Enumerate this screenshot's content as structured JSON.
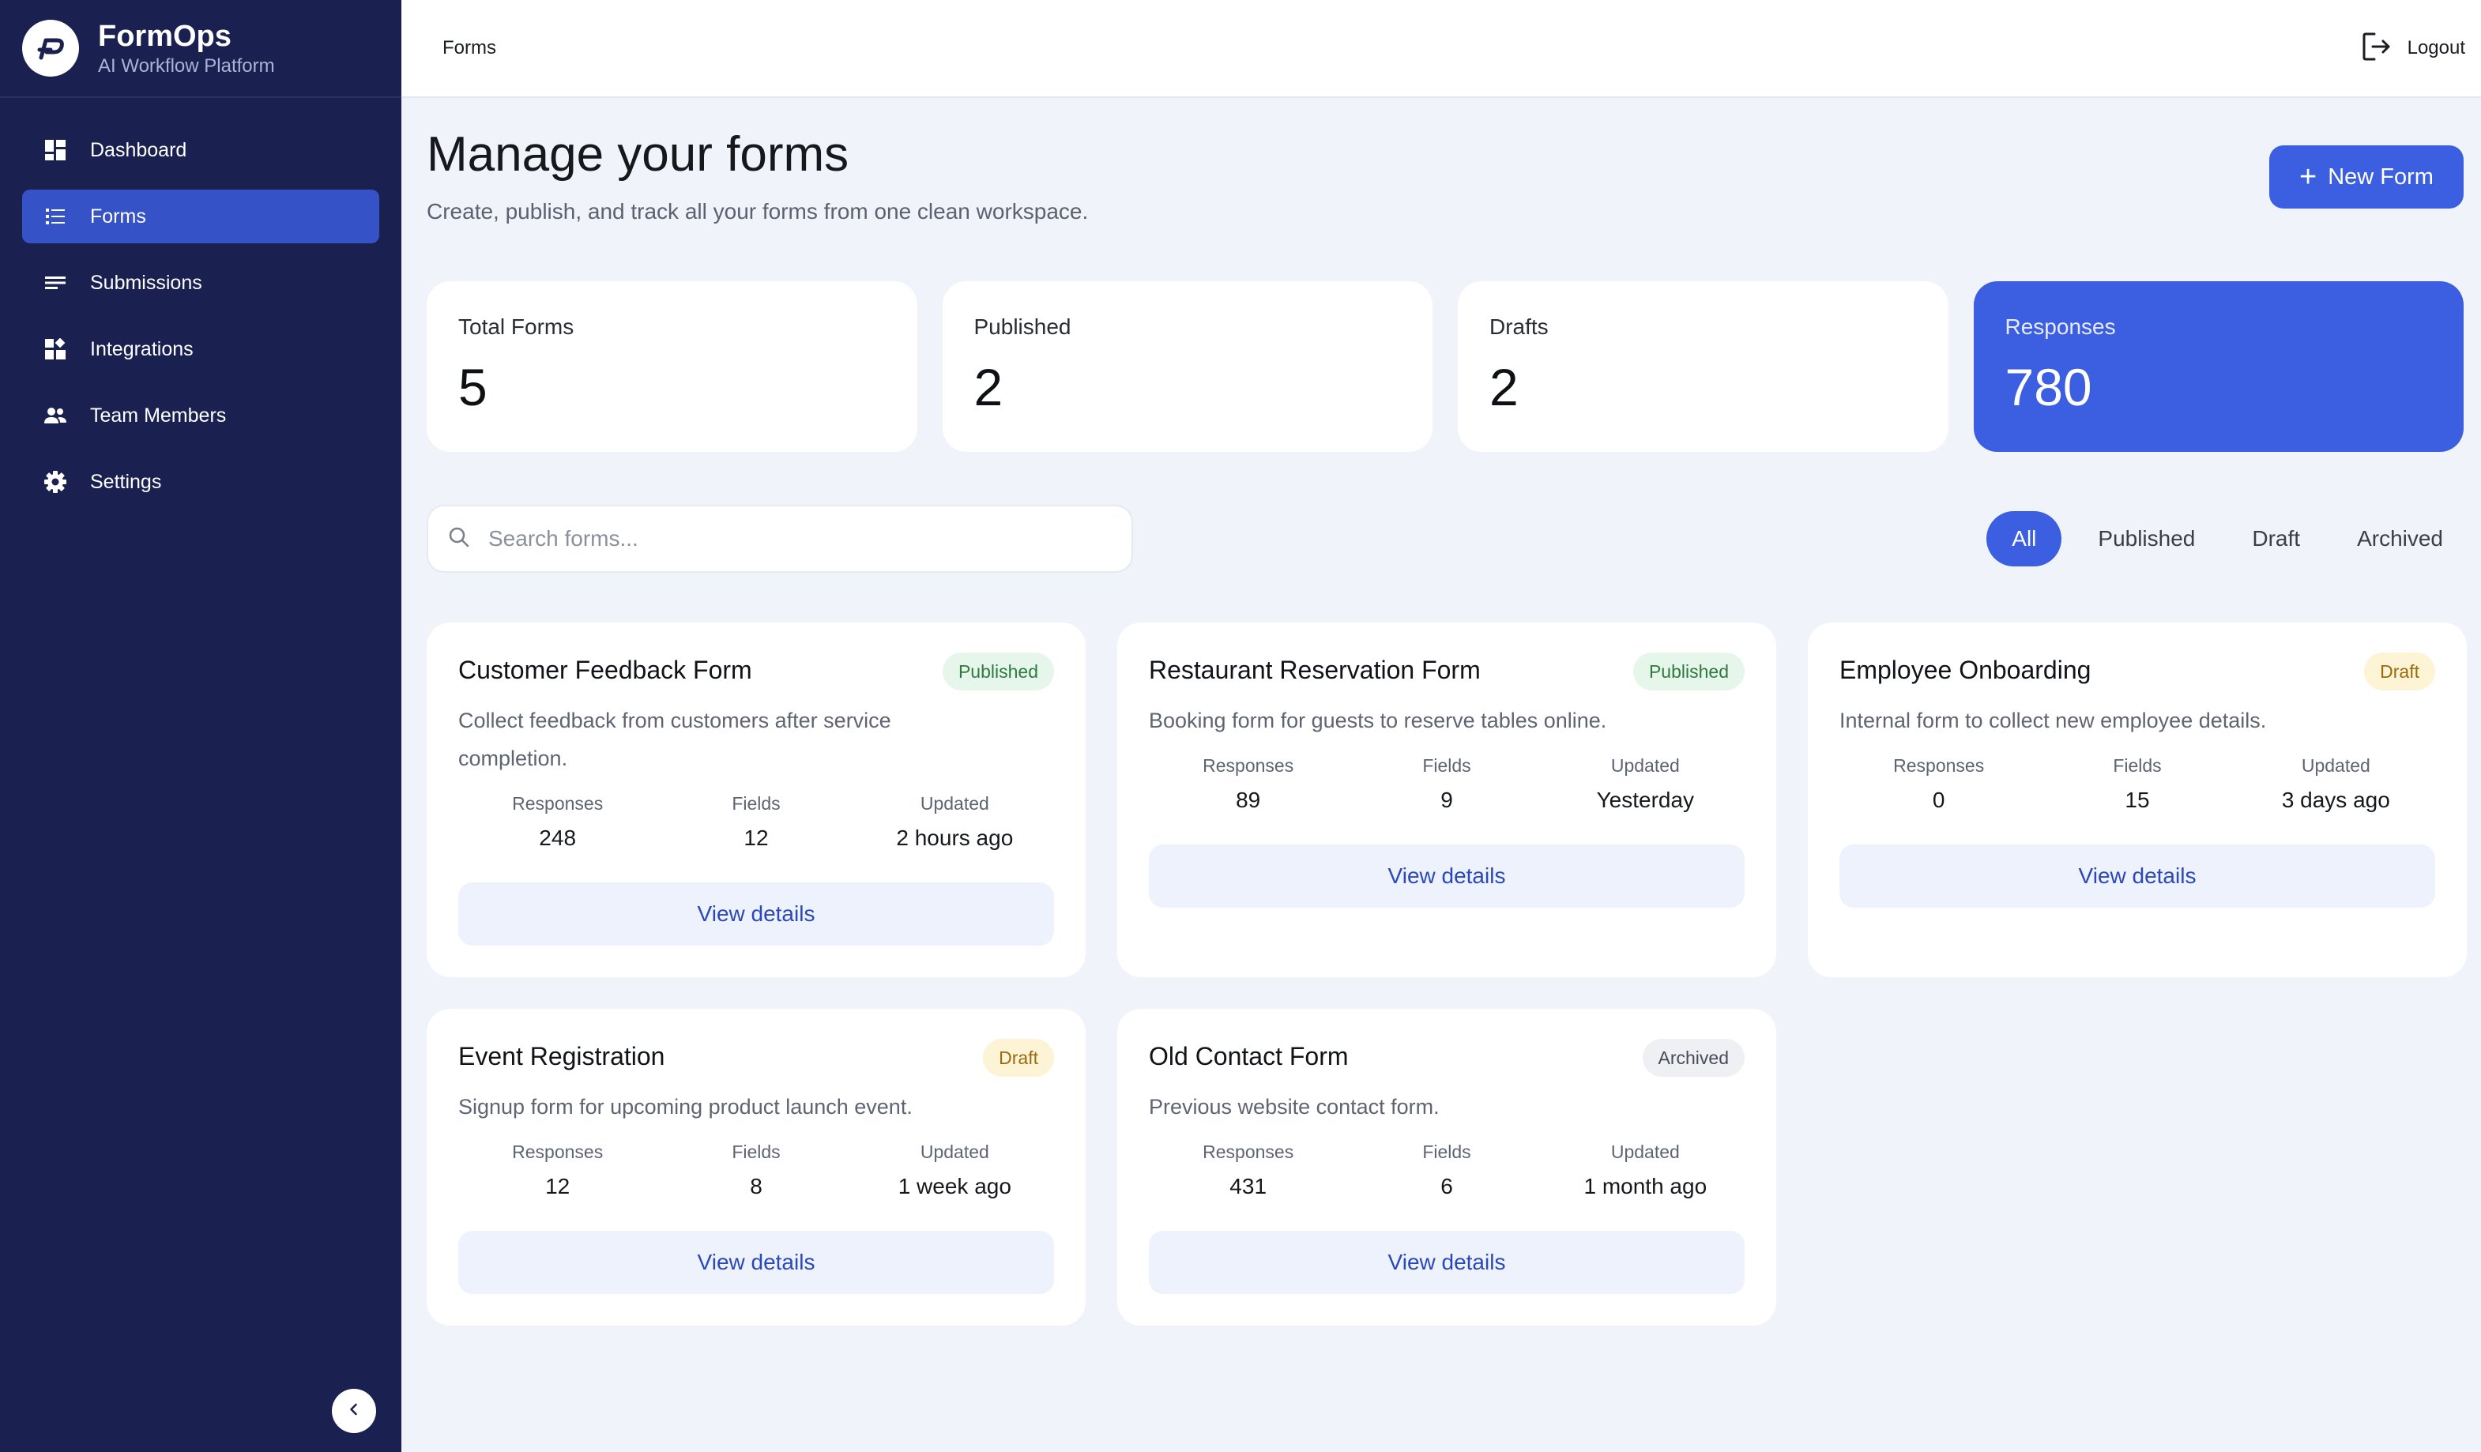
{
  "brand": {
    "name": "FormOps",
    "subtitle": "AI Workflow Platform"
  },
  "sidebar": {
    "items": [
      {
        "label": "Dashboard",
        "icon": "dashboard-icon"
      },
      {
        "label": "Forms",
        "icon": "list-icon",
        "active": true
      },
      {
        "label": "Submissions",
        "icon": "lines-icon"
      },
      {
        "label": "Integrations",
        "icon": "widgets-icon"
      },
      {
        "label": "Team Members",
        "icon": "people-icon"
      },
      {
        "label": "Settings",
        "icon": "gear-icon"
      }
    ]
  },
  "topbar": {
    "breadcrumb": "Forms",
    "logout_label": "Logout"
  },
  "page": {
    "title": "Manage your forms",
    "subtitle": "Create, publish, and track all your forms from one clean workspace.",
    "new_button": "New Form"
  },
  "stats": [
    {
      "label": "Total Forms",
      "value": "5"
    },
    {
      "label": "Published",
      "value": "2"
    },
    {
      "label": "Drafts",
      "value": "2"
    },
    {
      "label": "Responses",
      "value": "780"
    }
  ],
  "search": {
    "placeholder": "Search forms...",
    "value": ""
  },
  "filters": [
    "All",
    "Published",
    "Draft",
    "Archived"
  ],
  "metric_labels": {
    "responses": "Responses",
    "fields": "Fields",
    "updated": "Updated"
  },
  "view_label": "View details",
  "forms": [
    {
      "title": "Customer Feedback Form",
      "status": "Published",
      "description": "Collect feedback from customers after service completion.",
      "responses": "248",
      "fields": "12",
      "updated": "2 hours ago"
    },
    {
      "title": "Restaurant Reservation Form",
      "status": "Published",
      "description": "Booking form for guests to reserve tables online.",
      "responses": "89",
      "fields": "9",
      "updated": "Yesterday"
    },
    {
      "title": "Employee Onboarding",
      "status": "Draft",
      "description": "Internal form to collect new employee details.",
      "responses": "0",
      "fields": "15",
      "updated": "3 days ago"
    },
    {
      "title": "Event Registration",
      "status": "Draft",
      "description": "Signup form for upcoming product launch event.",
      "responses": "12",
      "fields": "8",
      "updated": "1 week ago"
    },
    {
      "title": "Old Contact Form",
      "status": "Archived",
      "description": "Previous website contact form.",
      "responses": "431",
      "fields": "6",
      "updated": "1 month ago"
    }
  ],
  "colors": {
    "sidebar_bg": "#1a2150",
    "accent": "#3b5fe0",
    "page_bg": "#f0f3f9",
    "published": "#2e7a3f",
    "draft": "#9a6a0e",
    "archived": "#474c57"
  }
}
